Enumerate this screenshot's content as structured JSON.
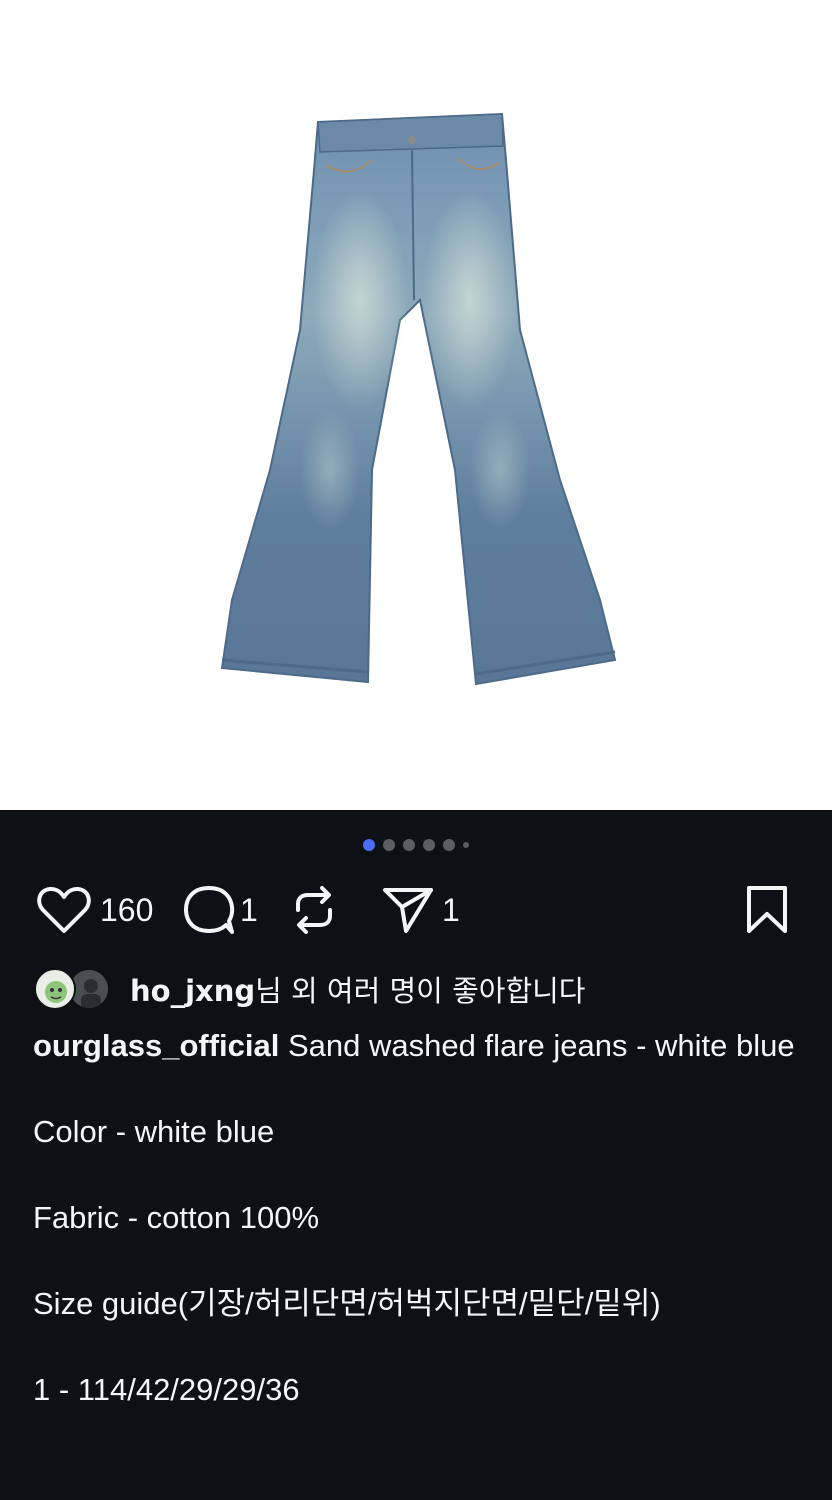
{
  "post": {
    "image": {
      "subject": "jeans-photo",
      "carousel": {
        "count": 6,
        "active_index": 0
      }
    },
    "actions": {
      "likes_count": "160",
      "comments_count": "1",
      "shares_count": "1"
    },
    "liked_by": {
      "user": "ho_jxng",
      "suffix": "님 외 여러 명이 좋아합니다"
    },
    "caption": {
      "username": "ourglass_official",
      "first_line": "Sand washed flare jeans - white blue",
      "lines": [
        "Color - white blue",
        "Fabric - cotton 100%",
        "Size guide(기장/허리단면/허벅지단면/밑단/밑위)",
        "1 - 114/42/29/29/36"
      ]
    }
  },
  "colors": {
    "background": "#0d1014",
    "text": "#f3f5f7",
    "carousel_active": "#4a6cf7",
    "carousel_inactive": "#5a5f66"
  },
  "icons": [
    "heart-icon",
    "comment-icon",
    "repost-icon",
    "send-icon",
    "bookmark-icon"
  ]
}
